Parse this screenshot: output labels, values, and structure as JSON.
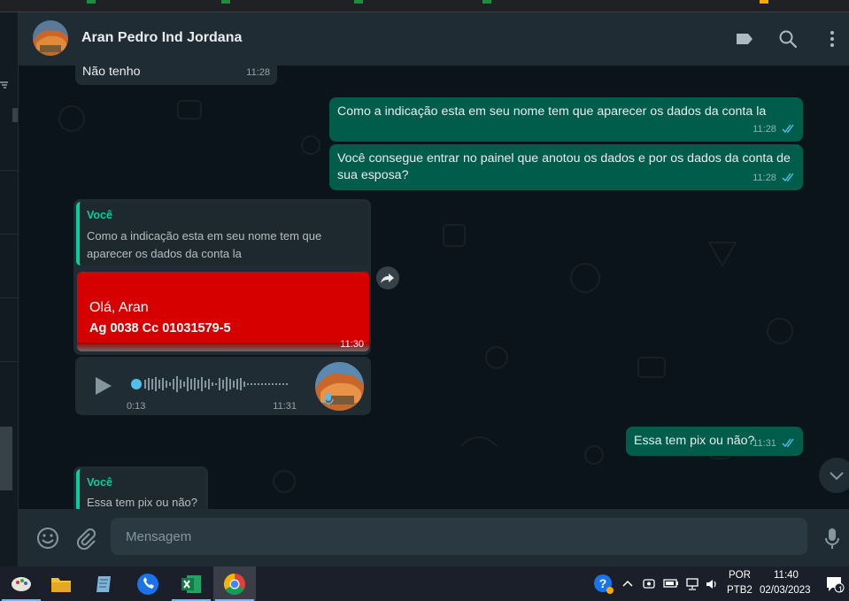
{
  "header": {
    "contact_name": "Aran Pedro Ind Jordana",
    "icons": [
      "label-icon",
      "search-icon",
      "menu-icon"
    ]
  },
  "messages": {
    "m1": {
      "text": "Não tenho",
      "time": "11:28"
    },
    "m2": {
      "text": "Como a indicação esta em seu nome tem que aparecer os dados da conta la",
      "time": "11:28"
    },
    "m3": {
      "line1": "Você consegue entrar no painel que anotou os dados e por os dados da conta de",
      "line2": "sua esposa?",
      "time": "11:28"
    },
    "m4": {
      "quote_author": "Você",
      "quote_line1": "Como a indicação esta em seu nome tem que",
      "quote_line2": "aparecer os dados da conta la",
      "card_greeting": "Olá, Aran",
      "card_account": "Ag 0038 Cc 01031579-5",
      "time": "11:30"
    },
    "m5": {
      "duration": "0:13",
      "time": "11:31"
    },
    "m6": {
      "text": "Essa tem pix ou não?",
      "time": "11:31"
    },
    "m7": {
      "quote_author": "Você",
      "quote_text": "Essa tem pix ou não?"
    }
  },
  "footer": {
    "placeholder": "Mensagem"
  },
  "taskbar": {
    "language": "POR",
    "layout": "PTB2",
    "time": "11:40",
    "date": "02/03/2023",
    "notification_count": "1"
  },
  "colors": {
    "chat_bg": "#0b141a",
    "incoming": "#202c33",
    "outgoing": "#005c4b",
    "accent": "#06cf9c",
    "ticks": "#53bdeb",
    "card_red": "#d70000"
  }
}
